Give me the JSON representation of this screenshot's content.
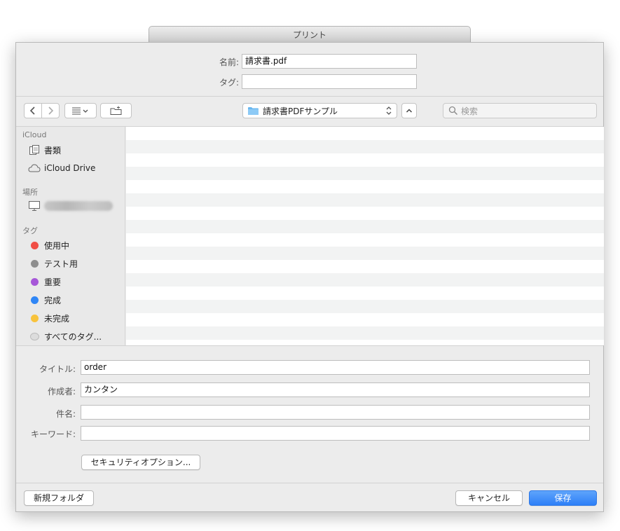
{
  "window": {
    "title": "プリント"
  },
  "save_form": {
    "name_label": "名前:",
    "name_value": "請求書.pdf",
    "tag_label": "タグ:",
    "tag_value": ""
  },
  "toolbar": {
    "back_icon": "chevron-left-icon",
    "forward_icon": "chevron-right-icon",
    "view_icon": "list-view-icon",
    "new_folder_icon": "new-folder-icon",
    "current_folder": "請求書PDFサンプル",
    "expand_icon": "chevron-up-icon",
    "search_placeholder": "検索"
  },
  "sidebar": {
    "icloud_header": "iCloud",
    "icloud_items": [
      {
        "label": "書類",
        "icon": "documents-icon"
      },
      {
        "label": "iCloud Drive",
        "icon": "cloud-icon"
      }
    ],
    "places_header": "場所",
    "places_items": [
      {
        "label": "",
        "icon": "computer-icon"
      }
    ],
    "tags_header": "タグ",
    "tags": [
      {
        "label": "使用中",
        "color": "#f04e45"
      },
      {
        "label": "テスト用",
        "color": "#8e8e8e"
      },
      {
        "label": "重要",
        "color": "#a657d8"
      },
      {
        "label": "完成",
        "color": "#2f86f6"
      },
      {
        "label": "未完成",
        "color": "#f8c33c"
      },
      {
        "label": "すべてのタグ...",
        "color": "#dcdcdc"
      }
    ]
  },
  "metadata": {
    "title_label": "タイトル:",
    "title_value": "order",
    "author_label": "作成者:",
    "author_value": "カンタン",
    "subject_label": "件名:",
    "subject_value": "",
    "keywords_label": "キーワード:",
    "keywords_value": "",
    "security_button": "セキュリティオプション..."
  },
  "footer": {
    "new_folder_button": "新規フォルダ",
    "cancel_button": "キャンセル",
    "save_button": "保存"
  },
  "colors": {
    "primary": "#2d7ff7",
    "sheet_background": "#ececec"
  }
}
